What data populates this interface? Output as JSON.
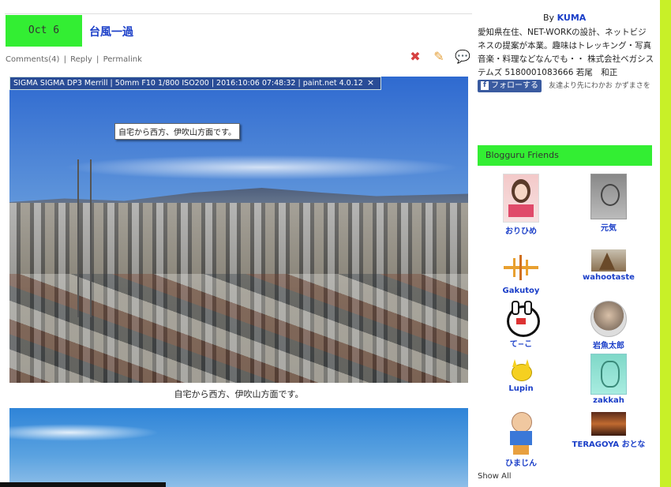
{
  "post": {
    "date": "Oct 6",
    "title": "台風一過",
    "meta": {
      "comments": "Comments(4)",
      "reply": "Reply",
      "permalink": "Permalink",
      "sep": "|"
    },
    "exif": "SIGMA SIGMA DP3 Merrill | 50mm F10 1/800 ISO200 | 2016:10:06 07:48:32 | paint.net 4.0.12",
    "exif_close": "×",
    "tooltip": "自宅から西方、伊吹山方面です。",
    "caption": "自宅から西方、伊吹山方面です。"
  },
  "icons": {
    "delete": "delete-icon",
    "edit": "edit-icon",
    "comment": "comment-icon"
  },
  "sidebar": {
    "by": "By",
    "author": "KUMA",
    "profile": "愛知県在住、NET-WORKの設計、ネットビジネスの提案が本業。趣味はトレッキング・写真 音楽・料理などなんでも・・ 株式会社ベガシステムズ 5180001083666 若尾　和正",
    "follow_label": "フォローする",
    "follow_f": "f",
    "follow_text": "友達より先にわかお かずまさを",
    "friends_title": "Blogguru Friends",
    "friends": [
      {
        "name": "おりひめ"
      },
      {
        "name": "元気"
      },
      {
        "name": "Gakutoy"
      },
      {
        "name": "wahootaste"
      },
      {
        "name": "て−こ"
      },
      {
        "name": "岩魚太郎"
      },
      {
        "name": "Lupin"
      },
      {
        "name": "zakkah"
      },
      {
        "name": "ひまじん"
      },
      {
        "name": "TERAGOYA おとな"
      }
    ],
    "show_all": "Show All"
  },
  "colors": {
    "accent_green": "#33ee33",
    "link_blue": "#1a3ec8",
    "side_bar": "#c8f028"
  }
}
